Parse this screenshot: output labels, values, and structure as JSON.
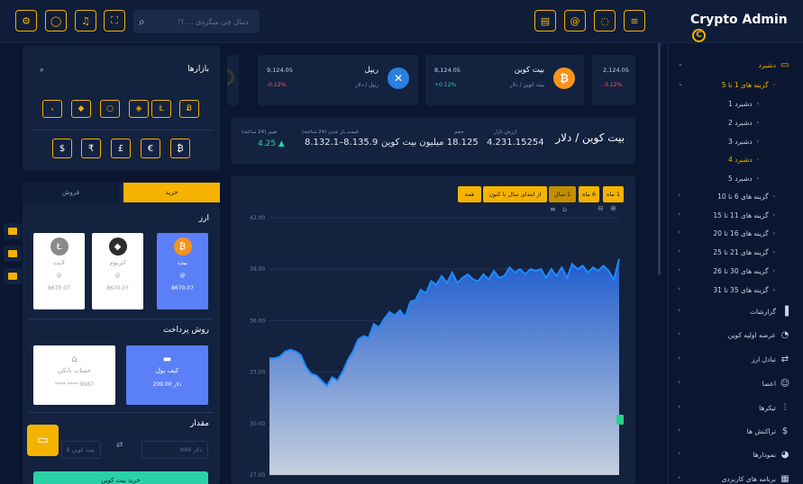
{
  "app": {
    "title": "Crypto Admin",
    "logo_glyph": "C"
  },
  "topbar": {
    "search_placeholder": "دنبال چی میگردی ... ؟!",
    "icons": [
      "gear-icon",
      "user-icon",
      "bell-icon",
      "fullscreen-icon",
      "search-icon",
      "clipboard-icon",
      "at-icon",
      "chat-icon",
      "menu-icon"
    ]
  },
  "sidebar": {
    "items": [
      {
        "label": "دشبرد",
        "icon": "▭",
        "active": true,
        "expanded": true
      },
      {
        "label": "گزینه های 1 تا 5",
        "active": true,
        "expanded": true
      },
      {
        "label": "دشبرد 1"
      },
      {
        "label": "دشبرد 2"
      },
      {
        "label": "دشبرد 3"
      },
      {
        "label": "دشبرد 4",
        "active": true
      },
      {
        "label": "دشبرد 5"
      },
      {
        "label": "گزینه های 6 تا 10"
      },
      {
        "label": "گزینه های 11 تا 15"
      },
      {
        "label": "گزینه های 16 تا 20"
      },
      {
        "label": "گزینه های 21 تا 25"
      },
      {
        "label": "گزینه های 30 تا 26"
      },
      {
        "label": "گزینه های 35 تا 31"
      },
      {
        "label": "گزارشات",
        "icon": "▐"
      },
      {
        "label": "عرضه اولیه کوین",
        "icon": "◔"
      },
      {
        "label": "تبادل ارز",
        "icon": "⇄"
      },
      {
        "label": "اعضا",
        "icon": "☺"
      },
      {
        "label": "تیکرها",
        "icon": "⫶"
      },
      {
        "label": "تراکنش ها",
        "icon": "$"
      },
      {
        "label": "نمودارها",
        "icon": "◕"
      },
      {
        "label": "برنامه های کاربردی",
        "icon": "▦"
      }
    ]
  },
  "tickers": [
    {
      "name": "بیت کوین",
      "sub": "بیت کوین / دلار",
      "value": "8,124.05",
      "change": "+0.12%",
      "positive": true,
      "color": "#f7931a",
      "glyph": "₿"
    },
    {
      "name": "ریپل",
      "sub": "ریپل / دلار",
      "value": "9,124.05",
      "change": "-0.12%",
      "positive": false,
      "color": "#2a7fe0",
      "glyph": "✕"
    },
    {
      "name": "",
      "sub": "",
      "value": "2,124.05",
      "change": "-3.12%",
      "positive": false
    }
  ],
  "market_summary": {
    "pair": "بیت کوین / دلار",
    "stats": [
      {
        "label": "ارزش بازار",
        "value": "4.231.15254"
      },
      {
        "label": "حجم",
        "value": "18.125 میلیون بیت کوین"
      },
      {
        "label": "قیمت باز شدن (24 ساعته)",
        "value": "8.132.1–8.135.9"
      },
      {
        "label": "تغییر (24 ساعته)",
        "value": "4.25"
      }
    ]
  },
  "chart_ranges": [
    "1 ماه",
    "6 ماه",
    "1 سال",
    "از ابتدای سال تا کنون",
    "همه"
  ],
  "chart_data": {
    "type": "area",
    "ylim": [
      27,
      42
    ],
    "yticks": [
      "42.00",
      "39.00",
      "36.00",
      "33.00",
      "30.00",
      "27.00"
    ],
    "values": [
      33.8,
      33.8,
      33.9,
      34.2,
      34.3,
      34.2,
      34.0,
      33.3,
      32.9,
      32.8,
      32.5,
      32.2,
      32.7,
      32.5,
      33.0,
      33.7,
      34.2,
      34.9,
      35.1,
      35.0,
      35.8,
      35.6,
      36.1,
      36.5,
      36.3,
      36.6,
      36.2,
      37.1,
      37.2,
      37.8,
      37.6,
      38.3,
      38.1,
      38.6,
      38.2,
      38.8,
      38.2,
      38.5,
      38.7,
      38.4,
      38.3,
      38.7,
      38.4,
      38.9,
      38.5,
      38.6,
      39.1,
      38.8,
      39.0,
      38.7,
      39.0,
      38.9,
      39.0,
      38.5,
      39.0,
      38.6,
      39.1,
      38.5,
      39.3,
      39.0,
      39.2,
      38.8,
      39.1,
      38.9,
      39.2,
      38.9,
      38.4,
      39.6
    ]
  },
  "markets": {
    "title": "بازارها",
    "coin_icons": [
      "ₛ",
      "◆",
      "○",
      "◈",
      "Ł",
      "Ƀ"
    ],
    "currencies": [
      "$",
      "₹",
      "£",
      "€",
      "₿"
    ]
  },
  "trade": {
    "tab_buy": "خرید",
    "tab_sell": "فروش",
    "currency_title": "ارز",
    "coins": [
      {
        "name": "بیت",
        "price": "8670.07",
        "selected": true,
        "glyph": "₿",
        "color": "#f7931a"
      },
      {
        "name": "اتریوم",
        "price": "8670.07",
        "selected": false,
        "glyph": "◆",
        "color": "#2d2d2d"
      },
      {
        "name": "لایت",
        "price": "8670.07",
        "selected": false,
        "glyph": "Ł",
        "color": "#8a8a8a"
      }
    ],
    "payment_title": "روش پرداخت",
    "payments": [
      {
        "name": "کیف پول",
        "value": "209.00 دلار",
        "selected": true,
        "icon": "▬"
      },
      {
        "name": "حساب بانکی",
        "value": "**** **** 8987",
        "selected": false,
        "icon": "⌂"
      }
    ],
    "amount_title": "مقدار",
    "amount_left_placeholder": "8 بیت کوین",
    "amount_right_placeholder": "899 دلار",
    "submit_label": "خرید بیت کوین"
  }
}
